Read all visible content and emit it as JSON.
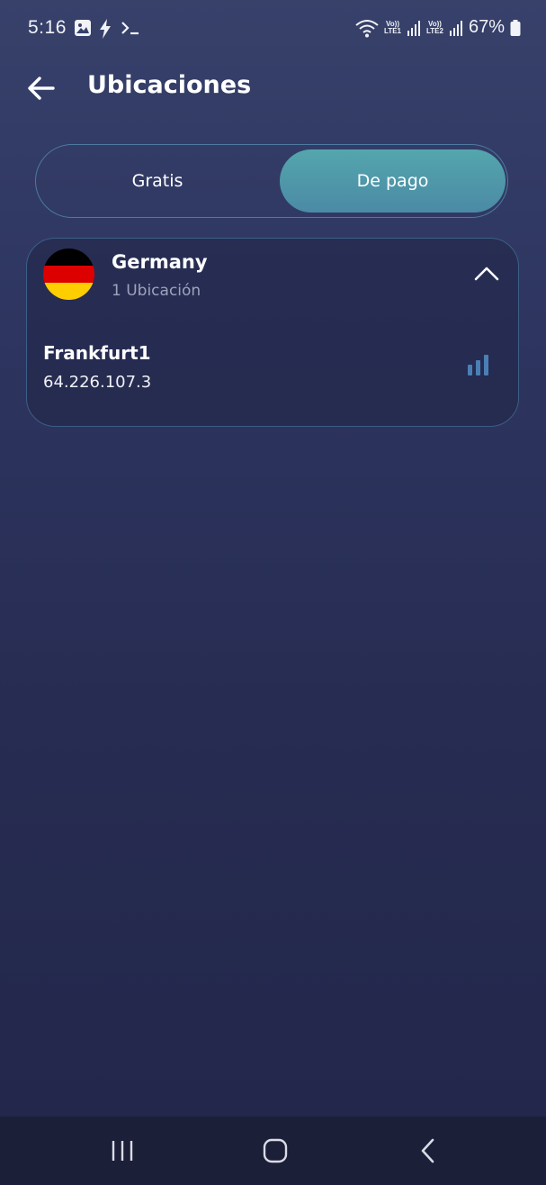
{
  "status_bar": {
    "time": "5:16",
    "lte1": "LTE1",
    "lte2": "LTE2",
    "volte": "Vo))",
    "battery": "67%"
  },
  "header": {
    "title": "Ubicaciones",
    "back_icon": "arrow-left-icon"
  },
  "tabs": [
    {
      "label": "Gratis",
      "selected": false
    },
    {
      "label": "De pago",
      "selected": true
    }
  ],
  "countries": [
    {
      "name": "Germany",
      "count_label": "1 Ubicación",
      "expanded": true,
      "flag_colors": [
        "#000000",
        "#dd0000",
        "#ffce00"
      ],
      "locations": [
        {
          "city": "Frankfurt1",
          "ip": "64.226.107.3",
          "signal_icon": "signal-bars-icon"
        }
      ]
    }
  ],
  "colors": {
    "accent": "#4f97a9",
    "signal": "#4a7fb5",
    "card_border": "#3b5f86"
  },
  "nav_bar": {
    "icons": [
      "recent-apps-icon",
      "home-icon",
      "back-icon"
    ]
  }
}
